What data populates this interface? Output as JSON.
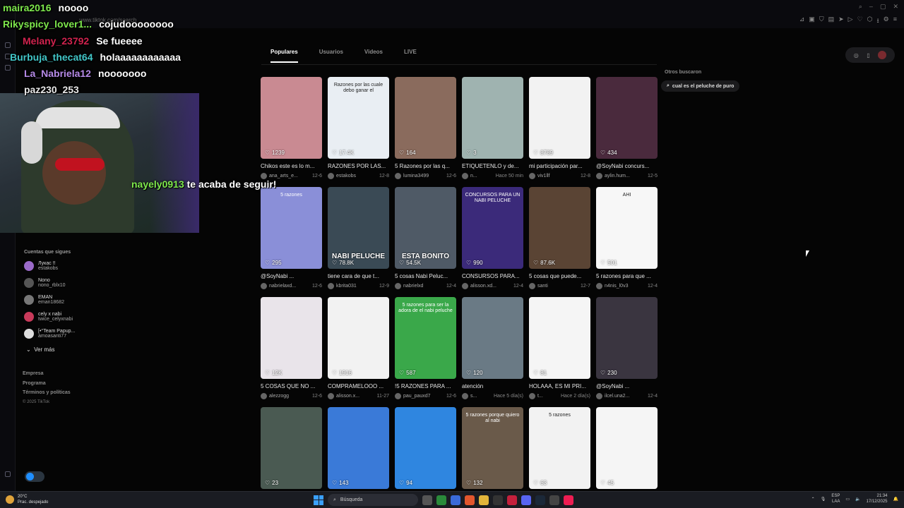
{
  "browser": {
    "url_text": "www.tiktok.com/search"
  },
  "tabs": [
    {
      "label": "Populares",
      "active": true
    },
    {
      "label": "Usuarios",
      "active": false
    },
    {
      "label": "Videos",
      "active": false
    },
    {
      "label": "LIVE",
      "active": false
    }
  ],
  "others_searched": {
    "title": "Otros buscaron",
    "suggestion": "cual es el peluche de puro"
  },
  "videos": [
    {
      "likes": "1239",
      "title": "Chikos este es lo m...",
      "author": "ana_arts_e...",
      "date": "12-6",
      "thumb_color": "#c98a92",
      "thumb_text": "",
      "caption": ""
    },
    {
      "likes": "17.4K",
      "title": "RAZONES POR LAS...",
      "author": "estakobs",
      "date": "12-8",
      "thumb_color": "#e9eef3",
      "thumb_text": "Razones por las cuale debo ganar el",
      "caption": ""
    },
    {
      "likes": "164",
      "title": "5 Razones por las q...",
      "author": "lumina3499",
      "date": "12-6",
      "thumb_color": "#8a6b5d",
      "thumb_text": "",
      "caption": ""
    },
    {
      "likes": "3",
      "title": "ETIQUETENLO y de...",
      "author": "n...",
      "date": "Hace 50 min",
      "thumb_color": "#9fb3b0",
      "thumb_text": "",
      "caption": ""
    },
    {
      "likes": "8789",
      "title": "mi participación par...",
      "author": "viv1llf",
      "date": "12-8",
      "thumb_color": "#f2f2f2",
      "thumb_text": "",
      "caption": ""
    },
    {
      "likes": "434",
      "title": "@SoyNabi concurs...",
      "author": "aylin.hum...",
      "date": "12-5",
      "thumb_color": "#4a2a3d",
      "thumb_text": "",
      "caption": ""
    },
    {
      "likes": "295",
      "title": "@SoyNabi ...",
      "author": "nabrielaxd...",
      "date": "12-6",
      "thumb_color": "#8a8fd8",
      "thumb_text": "5 razones",
      "caption": ""
    },
    {
      "likes": "78.8K",
      "title": "tiene cara de que t...",
      "author": "kbrita031",
      "date": "12-9",
      "thumb_color": "#3a4a55",
      "thumb_text": "",
      "caption": "NABI PELUCHE"
    },
    {
      "likes": "54.5K",
      "title": "5 cosas Nabi Peluc...",
      "author": "nabrielxd",
      "date": "12-4",
      "thumb_color": "#4f5a66",
      "thumb_text": "",
      "caption": "ESTA BONITO"
    },
    {
      "likes": "990",
      "title": "CONSURSOS PARA...",
      "author": "alisson.xd...",
      "date": "12-4",
      "thumb_color": "#3b2a7a",
      "thumb_text": "CONCURSOS PARA UN NABI PELUCHE",
      "caption": ""
    },
    {
      "likes": "87.6K",
      "title": "5 cosas que puede...",
      "author": "santi",
      "date": "12-7",
      "thumb_color": "#5a4434",
      "thumb_text": "",
      "caption": ""
    },
    {
      "likes": "501",
      "title": "5 razones para que ...",
      "author": "n4nis_l0v3",
      "date": "12-4",
      "thumb_color": "#f7f7f7",
      "thumb_text": "AHI",
      "caption": ""
    },
    {
      "likes": "12K",
      "title": "5 COSAS QUE NO ...",
      "author": "alezzogg",
      "date": "12-6",
      "thumb_color": "#e9e4ea",
      "thumb_text": "",
      "caption": ""
    },
    {
      "likes": "1916",
      "title": "COMPRAMELOOO ...",
      "author": "alisson.x...",
      "date": "11-27",
      "thumb_color": "#f2f2f2",
      "thumb_text": "",
      "caption": ""
    },
    {
      "likes": "587",
      "title": "!5 RAZONES PARA ...",
      "author": "pau_pauxd7",
      "date": "12-6",
      "thumb_color": "#3aa84a",
      "thumb_text": "5 razones para ser la adora de el nabi peluche",
      "caption": ""
    },
    {
      "likes": "120",
      "title": "atención",
      "author": "s...",
      "date": "Hace 5 día(s)",
      "thumb_color": "#6a7a85",
      "thumb_text": "",
      "caption": ""
    },
    {
      "likes": "81",
      "title": "HOLAAA, ES MI PRI...",
      "author": "t...",
      "date": "Hace 2 día(s)",
      "thumb_color": "#f5f5f5",
      "thumb_text": "",
      "caption": ""
    },
    {
      "likes": "230",
      "title": "@SoyNabi ...",
      "author": "ilcel.una2...",
      "date": "12-4",
      "thumb_color": "#3a3540",
      "thumb_text": "",
      "caption": ""
    },
    {
      "likes": "23",
      "title": "",
      "author": "",
      "date": "",
      "thumb_color": "#4a5a52",
      "thumb_text": "",
      "caption": ""
    },
    {
      "likes": "143",
      "title": "",
      "author": "",
      "date": "",
      "thumb_color": "#3a7ad8",
      "thumb_text": "",
      "caption": ""
    },
    {
      "likes": "94",
      "title": "",
      "author": "",
      "date": "",
      "thumb_color": "#2f86e0",
      "thumb_text": "",
      "caption": ""
    },
    {
      "likes": "132",
      "title": "",
      "author": "",
      "date": "",
      "thumb_color": "#6a5a4a",
      "thumb_text": "5 razones porque quiero al nabi",
      "caption": ""
    },
    {
      "likes": "63",
      "title": "",
      "author": "",
      "date": "",
      "thumb_color": "#f2f2f2",
      "thumb_text": "5 razones",
      "caption": ""
    },
    {
      "likes": "45",
      "title": "",
      "author": "",
      "date": "",
      "thumb_color": "#f5f5f5",
      "thumb_text": "",
      "caption": ""
    }
  ],
  "chat": [
    {
      "user": "maira2016",
      "msg": "noooo",
      "color": "#7ee84d"
    },
    {
      "user": "Rikyspicy_lover1...",
      "msg": "cojudoooooooo",
      "color": "#7ee84d"
    },
    {
      "user": "Melany_23792",
      "msg": "Se fueeee",
      "color": "#d0234e"
    },
    {
      "user": "Burbuja_thecat64",
      "msg": "holaaaaaaaaaaaa",
      "color": "#42c6c8"
    },
    {
      "user": "La_Nabriela12",
      "msg": "nooooooo",
      "color": "#b68ae8"
    },
    {
      "user": "paz230_253",
      "msg": "",
      "color": "#e8e8e8"
    }
  ],
  "alert": {
    "user": "nayely0913",
    "msg": "te acaba de seguir!"
  },
  "following": {
    "title": "Cuentas que sigues",
    "accounts": [
      {
        "name": "Лукас !!",
        "handle": "estakobs"
      },
      {
        "name": "Nono",
        "handle": "nono_rblx10"
      },
      {
        "name": "EMAN",
        "handle": "eman18682"
      },
      {
        "name": "cely x nabi",
        "handle": "twice_celyxnabi"
      },
      {
        "name": "[•°Team Papup...",
        "handle": "amoasanti77"
      }
    ],
    "see_more": "Ver más"
  },
  "footer": {
    "links": [
      "Empresa",
      "Programa",
      "Términos y políticas"
    ],
    "copyright": "© 2025 TikTok"
  },
  "taskbar": {
    "weather_temp": "20°C",
    "weather_desc": "Prac. despejado",
    "search": "Búsqueda",
    "lang1": "ESP",
    "lang2": "LAA",
    "time": "21:34",
    "date": "17/12/2025"
  }
}
